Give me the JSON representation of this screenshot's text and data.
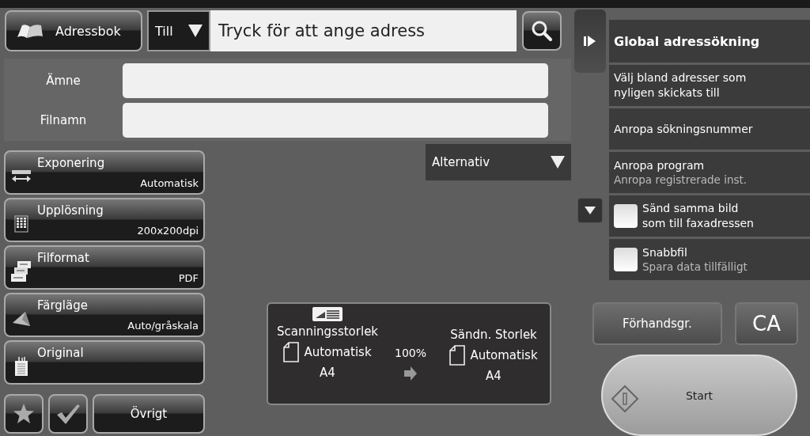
{
  "address_bar": {
    "addressbook_button": "Adressbok",
    "recipient_type": "Till",
    "address_field": {
      "placeholder": "Tryck för att ange adress"
    }
  },
  "fields": [
    {
      "label": "Ämne"
    },
    {
      "label": "Filnamn"
    }
  ],
  "settings": [
    {
      "kind": "exposure",
      "label": "Exponering",
      "value": "Automatisk"
    },
    {
      "kind": "resolution",
      "label": "Upplösning",
      "value": "200x200dpi"
    },
    {
      "kind": "format",
      "label": "Filformat",
      "value": "PDF"
    },
    {
      "kind": "color",
      "label": "Färgläge",
      "value": "Auto/gråskala"
    },
    {
      "kind": "original",
      "label": "Original"
    }
  ],
  "options_dropdown": "Alternativ",
  "other_button": "Övrigt",
  "summary": {
    "scan_label": "Scanningsstorlek",
    "scan_value": "Automatisk",
    "scan_paper": "A4",
    "ratio": "100%",
    "send_label": "Sändn. Storlek",
    "send_value": "Automatisk",
    "send_paper": "A4"
  },
  "sidebar": {
    "items": [
      {
        "kind": "title",
        "label": "Global adressökning"
      },
      {
        "kind": "action",
        "label": "Välj bland adresser som nyligen skickats till"
      },
      {
        "kind": "action",
        "label": "Anropa sökningsnummer"
      },
      {
        "kind": "action",
        "label": "Anropa program",
        "sub": "Anropa registrerade inst."
      },
      {
        "kind": "checkbox",
        "label": "Sänd samma bild som till faxadressen",
        "checked": false
      },
      {
        "kind": "checkbox",
        "label": "Snabbfil",
        "sub": "Spara data tillfälligt",
        "checked": false
      }
    ]
  },
  "preview_button": "Förhandsgr.",
  "clear_all_button": "CA",
  "start_button": "Start"
}
